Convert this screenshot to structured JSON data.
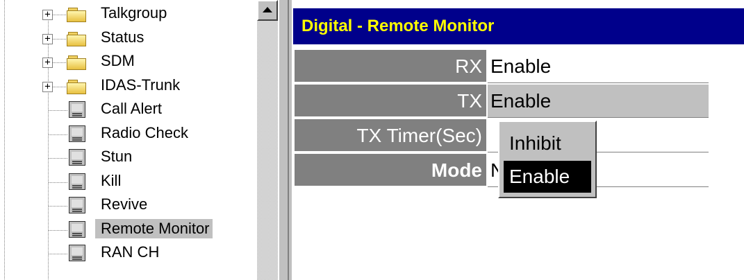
{
  "tree": {
    "items": [
      {
        "label": "Talkgroup",
        "type": "folder",
        "expandable": true,
        "expander": "+"
      },
      {
        "label": "Status",
        "type": "folder",
        "expandable": true,
        "expander": "+"
      },
      {
        "label": "SDM",
        "type": "folder",
        "expandable": true,
        "expander": "+"
      },
      {
        "label": "IDAS-Trunk",
        "type": "folder",
        "expandable": true,
        "expander": "+"
      },
      {
        "label": "Call Alert",
        "type": "item"
      },
      {
        "label": "Radio Check",
        "type": "item"
      },
      {
        "label": "Stun",
        "type": "item"
      },
      {
        "label": "Kill",
        "type": "item"
      },
      {
        "label": "Revive",
        "type": "item"
      },
      {
        "label": "Remote Monitor",
        "type": "item",
        "selected": true
      },
      {
        "label": "RAN CH",
        "type": "item"
      }
    ]
  },
  "panel": {
    "title": "Digital - Remote Monitor",
    "rows": [
      {
        "label": "RX",
        "value": "Enable"
      },
      {
        "label": "TX",
        "value": "Enable",
        "active": true
      },
      {
        "label": "TX Timer(Sec)",
        "value": ""
      },
      {
        "label": "Mode",
        "value": "N"
      }
    ]
  },
  "dropdown": {
    "options": [
      "Inhibit",
      "Enable"
    ],
    "highlighted": "Enable"
  },
  "colors": {
    "title_bg": "#00008b",
    "title_text": "#ffff00",
    "label_bg": "#808080",
    "selection_bg": "#c0c0c0",
    "highlight_bg": "#000000"
  },
  "icons": {
    "folder": "folder-icon",
    "item": "document-icon",
    "scroll_up": "scroll-up-arrow-icon"
  }
}
